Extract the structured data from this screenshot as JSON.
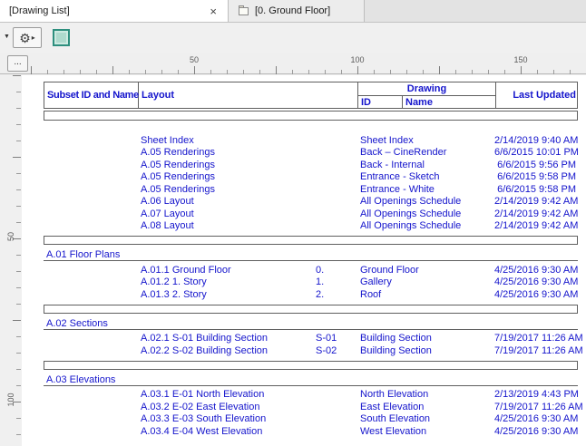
{
  "tabs": [
    {
      "label": "[Drawing List]",
      "active": true
    },
    {
      "label": "[0. Ground Floor]",
      "active": false
    }
  ],
  "icons": {
    "close": "×",
    "dropdown_arrow": "▼",
    "gear": "⚙",
    "flyout_arrow": "▸"
  },
  "ruler": {
    "corner_label": "...",
    "h": [
      "50",
      "100",
      "150"
    ],
    "v": [
      "50",
      "100"
    ]
  },
  "colors": {
    "text_blue": "#1414cc",
    "table_line": "#5f5f5f",
    "swatch_fill": "#aedacd",
    "swatch_border": "#2e8f7e"
  },
  "table": {
    "headers": {
      "subset": "Subset ID and Name",
      "layout": "Layout",
      "drawing": "Drawing",
      "id": "ID",
      "name": "Name",
      "last_updated": "Last Updated"
    },
    "groups": [
      {
        "title": "",
        "rows": [
          {
            "layout": "Sheet Index",
            "id": "",
            "name": "Sheet Index",
            "updated": "2/14/2019 9:40 AM"
          },
          {
            "layout": "A.05 Renderings",
            "id": "",
            "name": "Back – CineRender",
            "updated": "6/6/2015 10:01 PM"
          },
          {
            "layout": "A.05 Renderings",
            "id": "",
            "name": "Back - Internal",
            "updated": "6/6/2015 9:56 PM"
          },
          {
            "layout": "A.05 Renderings",
            "id": "",
            "name": "Entrance - Sketch",
            "updated": "6/6/2015 9:58 PM"
          },
          {
            "layout": "A.05 Renderings",
            "id": "",
            "name": "Entrance - White",
            "updated": "6/6/2015 9:58 PM"
          },
          {
            "layout": "A.06 Layout",
            "id": "",
            "name": "All Openings Schedule",
            "updated": "2/14/2019 9:42 AM"
          },
          {
            "layout": "A.07 Layout",
            "id": "",
            "name": "All Openings Schedule",
            "updated": "2/14/2019 9:42 AM"
          },
          {
            "layout": "A.08 Layout",
            "id": "",
            "name": "All Openings Schedule",
            "updated": "2/14/2019 9:42 AM"
          }
        ]
      },
      {
        "title": "A.01 Floor Plans",
        "rows": [
          {
            "layout": "A.01.1 Ground Floor",
            "id": "0.",
            "name": "Ground Floor",
            "updated": "4/25/2016 9:30 AM"
          },
          {
            "layout": "A.01.2 1. Story",
            "id": "1.",
            "name": "Gallery",
            "updated": "4/25/2016 9:30 AM"
          },
          {
            "layout": "A.01.3 2. Story",
            "id": "2.",
            "name": "Roof",
            "updated": "4/25/2016 9:30 AM"
          }
        ]
      },
      {
        "title": "A.02 Sections",
        "rows": [
          {
            "layout": "A.02.1 S-01 Building Section",
            "id": "S-01",
            "name": "Building Section",
            "updated": "7/19/2017 11:26 AM"
          },
          {
            "layout": "A.02.2 S-02 Building Section",
            "id": "S-02",
            "name": "Building Section",
            "updated": "7/19/2017 11:26 AM"
          }
        ]
      },
      {
        "title": "A.03 Elevations",
        "rows": [
          {
            "layout": "A.03.1 E-01 North Elevation",
            "id": "",
            "name": "North Elevation",
            "updated": "2/13/2019 4:43 PM"
          },
          {
            "layout": "A.03.2 E-02 East Elevation",
            "id": "",
            "name": "East Elevation",
            "updated": "7/19/2017 11:26 AM"
          },
          {
            "layout": "A.03.3 E-03 South Elevation",
            "id": "",
            "name": "South Elevation",
            "updated": "4/25/2016 9:30 AM"
          },
          {
            "layout": "A.03.4 E-04 West Elevation",
            "id": "",
            "name": "West Elevation",
            "updated": "4/25/2016 9:30 AM"
          }
        ]
      }
    ]
  }
}
